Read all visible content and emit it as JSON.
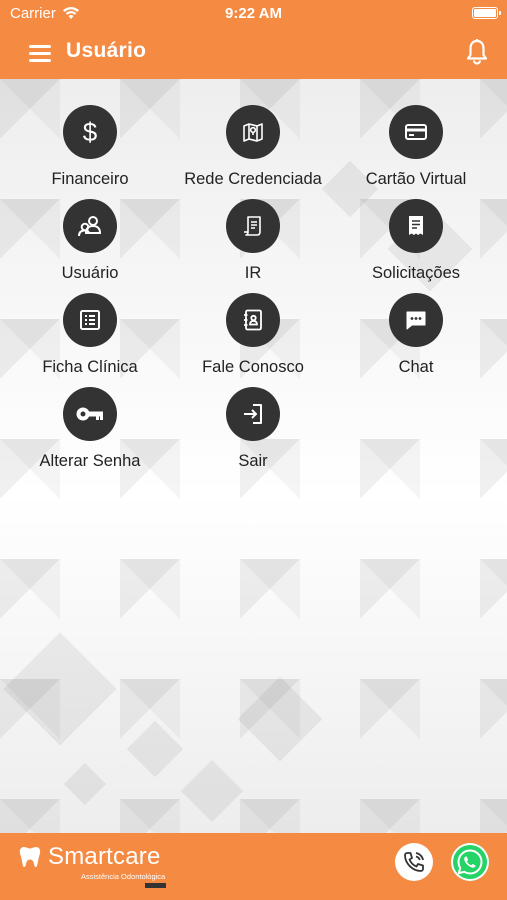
{
  "status_bar": {
    "carrier": "Carrier",
    "time": "9:22 AM"
  },
  "header": {
    "title": "Usuário",
    "menu_icon": "hamburger-icon",
    "notification_icon": "bell-icon"
  },
  "menu": {
    "items": [
      {
        "label": "Financeiro",
        "icon": "dollar-icon"
      },
      {
        "label": "Rede Credenciada",
        "icon": "map-icon"
      },
      {
        "label": "Cartão Virtual",
        "icon": "credit-card-icon"
      },
      {
        "label": "Usuário",
        "icon": "user-icon"
      },
      {
        "label": "IR",
        "icon": "document-icon"
      },
      {
        "label": "Solicitações",
        "icon": "receipt-icon"
      },
      {
        "label": "Ficha Clínica",
        "icon": "list-icon"
      },
      {
        "label": "Fale Conosco",
        "icon": "contacts-icon"
      },
      {
        "label": "Chat",
        "icon": "chat-icon"
      },
      {
        "label": "Alterar Senha",
        "icon": "key-icon"
      },
      {
        "label": "Sair",
        "icon": "exit-icon"
      }
    ]
  },
  "footer": {
    "brand": "Smartcare",
    "tagline": "Assistência Odontológica",
    "phone_icon": "phone-icon",
    "whatsapp_icon": "whatsapp-icon"
  },
  "colors": {
    "accent": "#F58A42",
    "icon_circle": "#333333",
    "whatsapp": "#25D366"
  }
}
